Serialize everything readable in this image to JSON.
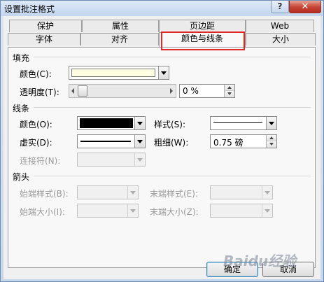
{
  "window": {
    "title": "设置批注格式",
    "help_label": "?",
    "close_label": "✕"
  },
  "tabs_back": [
    "保护",
    "属性",
    "页边距",
    "Web"
  ],
  "tabs_front": [
    "字体",
    "对齐",
    "颜色与线条",
    "大小"
  ],
  "active_tab": "颜色与线条",
  "fill": {
    "section": "填充",
    "color_label": "颜色(C):",
    "color_value": "#fffde0",
    "transparency_label": "透明度(T):",
    "transparency_value": "0 %",
    "transparency_fraction": 0.0
  },
  "line": {
    "section": "线条",
    "color_label": "颜色(O):",
    "color_value": "#000000",
    "style_label": "样式(S):",
    "dash_label": "虚实(D):",
    "weight_label": "粗细(W):",
    "weight_value": "0.75 磅",
    "connector_label": "连接符(N):"
  },
  "arrows": {
    "section": "箭头",
    "begin_style_label": "始端样式(B):",
    "end_style_label": "末端样式(E):",
    "begin_size_label": "始端大小(I):",
    "end_size_label": "末端大小(Z):"
  },
  "buttons": {
    "ok": "确定",
    "cancel": "取消"
  },
  "watermark": "Baidu经验",
  "colors": {
    "highlight": "#e02828"
  }
}
